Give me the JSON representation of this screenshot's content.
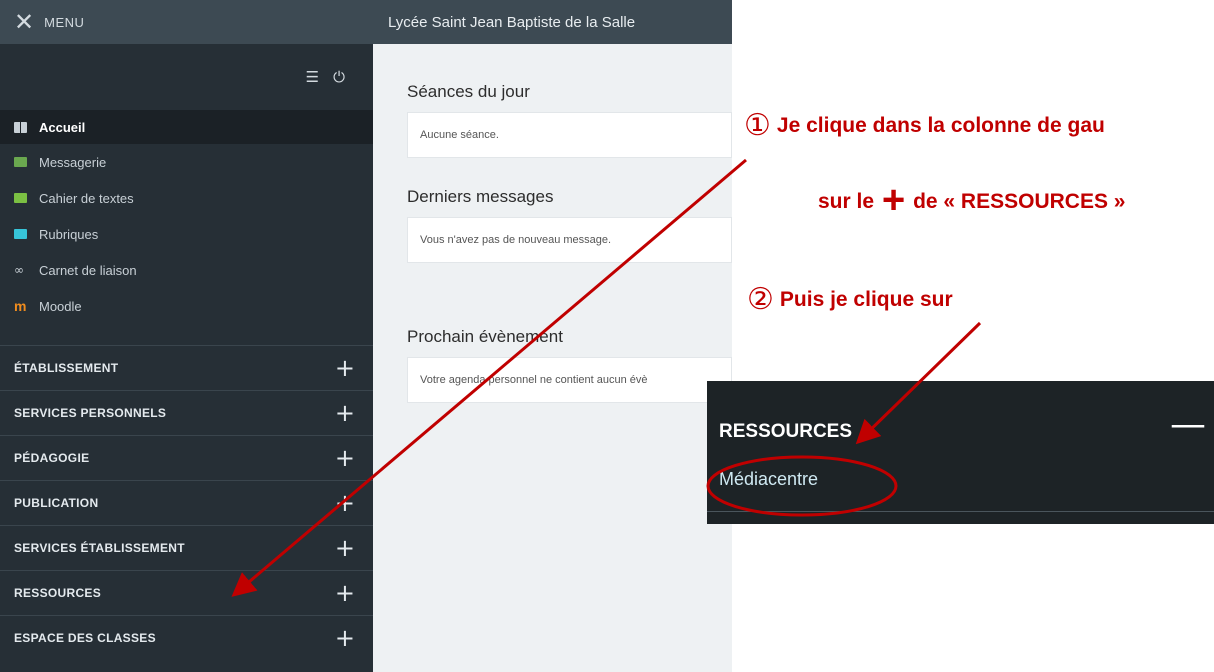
{
  "sidebar": {
    "menu_label": "MENU",
    "menu_icon": "close-icon",
    "nav": [
      {
        "label": "Accueil",
        "icon": "grid-icon",
        "active": true
      },
      {
        "label": "Messagerie",
        "icon": "mail-icon"
      },
      {
        "label": "Cahier de textes",
        "icon": "book-icon"
      },
      {
        "label": "Rubriques",
        "icon": "rubric-icon"
      },
      {
        "label": "Carnet de liaison",
        "icon": "link-icon"
      },
      {
        "label": "Moodle",
        "icon": "moodle-icon"
      }
    ],
    "sections": [
      {
        "label": "ÉTABLISSEMENT"
      },
      {
        "label": "SERVICES PERSONNELS"
      },
      {
        "label": "PÉDAGOGIE"
      },
      {
        "label": "PUBLICATION"
      },
      {
        "label": "SERVICES ÉTABLISSEMENT"
      },
      {
        "label": "RESSOURCES"
      },
      {
        "label": "ESPACE DES CLASSES"
      }
    ],
    "plus_symbol": "+"
  },
  "header": {
    "title": "Lycée Saint Jean Baptiste de la Salle"
  },
  "main": {
    "blocks": [
      {
        "title": "Séances du jour",
        "content": "Aucune séance."
      },
      {
        "title": "Derniers messages",
        "content": "Vous n'avez pas de nouveau message."
      },
      {
        "title": "Prochain évènement",
        "content": "Votre agenda personnel ne contient aucun évè"
      }
    ]
  },
  "annotations": {
    "step1_num": "①",
    "step1_line1": "Je clique dans la colonne de gau",
    "step1_line2_pre": "sur le",
    "step1_plus": "+",
    "step1_line2_post": "de « RESSOURCES »",
    "step2_num": "②",
    "step2_text": "Puis je clique sur"
  },
  "inset": {
    "heading": "RESSOURCES",
    "minus": "—",
    "link": "Médiacentre"
  },
  "colors": {
    "sidebar_bg": "#262f36",
    "topbar_bg": "#3d4a53",
    "annotation_red": "#c00000",
    "content_bg": "#eef1f3"
  }
}
